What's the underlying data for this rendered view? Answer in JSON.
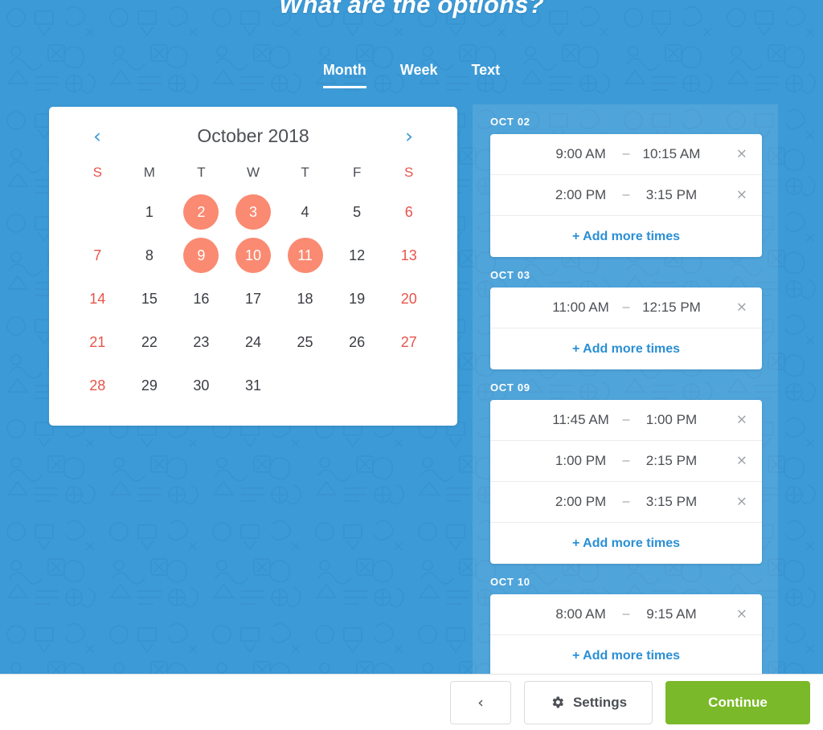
{
  "header": {
    "title": "What are the options?"
  },
  "tabs": [
    {
      "label": "Month",
      "active": true
    },
    {
      "label": "Week",
      "active": false
    },
    {
      "label": "Text",
      "active": false
    }
  ],
  "calendar": {
    "prev_icon": "chevron-left-icon",
    "next_icon": "chevron-right-icon",
    "month_label": "October 2018",
    "weekday_headers": [
      "S",
      "M",
      "T",
      "W",
      "T",
      "F",
      "S"
    ],
    "weeks": [
      [
        {
          "label": "",
          "empty": true
        },
        {
          "label": "1",
          "selected": false,
          "weekend": false
        },
        {
          "label": "2",
          "selected": true,
          "weekend": false
        },
        {
          "label": "3",
          "selected": true,
          "weekend": false
        },
        {
          "label": "4",
          "selected": false,
          "weekend": false
        },
        {
          "label": "5",
          "selected": false,
          "weekend": false
        },
        {
          "label": "6",
          "selected": false,
          "weekend": true
        }
      ],
      [
        {
          "label": "7",
          "selected": false,
          "weekend": true
        },
        {
          "label": "8",
          "selected": false,
          "weekend": false
        },
        {
          "label": "9",
          "selected": true,
          "weekend": false
        },
        {
          "label": "10",
          "selected": true,
          "weekend": false
        },
        {
          "label": "11",
          "selected": true,
          "weekend": false
        },
        {
          "label": "12",
          "selected": false,
          "weekend": false
        },
        {
          "label": "13",
          "selected": false,
          "weekend": true
        }
      ],
      [
        {
          "label": "14",
          "selected": false,
          "weekend": true
        },
        {
          "label": "15",
          "selected": false,
          "weekend": false
        },
        {
          "label": "16",
          "selected": false,
          "weekend": false
        },
        {
          "label": "17",
          "selected": false,
          "weekend": false
        },
        {
          "label": "18",
          "selected": false,
          "weekend": false
        },
        {
          "label": "19",
          "selected": false,
          "weekend": false
        },
        {
          "label": "20",
          "selected": false,
          "weekend": true
        }
      ],
      [
        {
          "label": "21",
          "selected": false,
          "weekend": true
        },
        {
          "label": "22",
          "selected": false,
          "weekend": false
        },
        {
          "label": "23",
          "selected": false,
          "weekend": false
        },
        {
          "label": "24",
          "selected": false,
          "weekend": false
        },
        {
          "label": "25",
          "selected": false,
          "weekend": false
        },
        {
          "label": "26",
          "selected": false,
          "weekend": false
        },
        {
          "label": "27",
          "selected": false,
          "weekend": true
        }
      ],
      [
        {
          "label": "28",
          "selected": false,
          "weekend": true
        },
        {
          "label": "29",
          "selected": false,
          "weekend": false
        },
        {
          "label": "30",
          "selected": false,
          "weekend": false
        },
        {
          "label": "31",
          "selected": false,
          "weekend": false
        },
        {
          "label": "",
          "empty": true
        },
        {
          "label": "",
          "empty": true
        },
        {
          "label": "",
          "empty": true
        }
      ]
    ]
  },
  "options": {
    "add_more_label": "+ Add more times",
    "remove_icon": "close-icon",
    "dash": "–",
    "groups": [
      {
        "date_label": "OCT 02",
        "slots": [
          {
            "start": "9:00 AM",
            "end": "10:15 AM"
          },
          {
            "start": "2:00 PM",
            "end": "3:15 PM"
          }
        ]
      },
      {
        "date_label": "OCT 03",
        "slots": [
          {
            "start": "11:00 AM",
            "end": "12:15 PM"
          }
        ]
      },
      {
        "date_label": "OCT 09",
        "slots": [
          {
            "start": "11:45 AM",
            "end": "1:00 PM"
          },
          {
            "start": "1:00 PM",
            "end": "2:15 PM"
          },
          {
            "start": "2:00 PM",
            "end": "3:15 PM"
          }
        ]
      },
      {
        "date_label": "OCT 10",
        "slots": [
          {
            "start": "8:00 AM",
            "end": "9:15 AM"
          }
        ]
      }
    ]
  },
  "footer": {
    "back_label": "‹",
    "back_icon": "chevron-left-icon",
    "settings_label": "Settings",
    "settings_icon": "gear-icon",
    "continue_label": "Continue"
  },
  "colors": {
    "background_blue": "#3c9ad6",
    "selected_day": "#fa8a72",
    "weekend_red": "#e8544a",
    "link_blue": "#2a8fd4",
    "continue_green": "#7ab929"
  }
}
